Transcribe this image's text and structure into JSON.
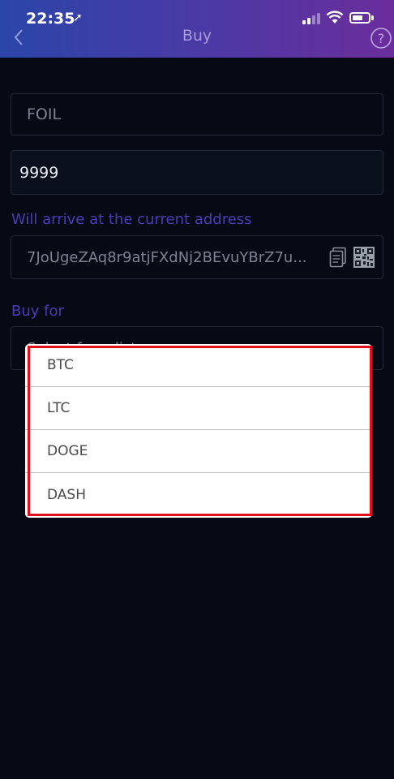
{
  "status_bar": {
    "time": "22:35"
  },
  "nav": {
    "title": "Buy",
    "back_icon": "chevron-left-icon",
    "help_icon": "question-circle-icon"
  },
  "form": {
    "token_value": "FOIL",
    "amount_value": "9999",
    "address_label": "Will arrive at the current address",
    "address_value": "7JoUgeZAq8r9atjFXdNj2BEvuYBrZ7u...",
    "buy_for_label": "Buy for",
    "buy_for_placeholder": "Select from list"
  },
  "dropdown": {
    "options": [
      "BTC",
      "LTC",
      "DOGE",
      "DASH"
    ]
  },
  "colors": {
    "header_start": "#2b45a8",
    "header_end": "#6b2d9c",
    "background": "#060a14",
    "label_accent": "#4a3cb5",
    "highlight": "#e0101e"
  }
}
